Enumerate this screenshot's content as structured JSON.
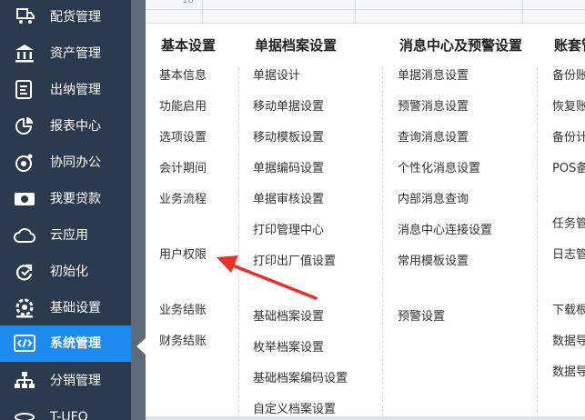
{
  "sidebar": {
    "items": [
      {
        "label": "配货管理",
        "icon": "truck-icon"
      },
      {
        "label": "资产管理",
        "icon": "bank-icon"
      },
      {
        "label": "出纳管理",
        "icon": "cashier-icon"
      },
      {
        "label": "报表中心",
        "icon": "pie-chart-icon"
      },
      {
        "label": "协同办公",
        "icon": "collaboration-icon"
      },
      {
        "label": "我要贷款",
        "icon": "money-icon"
      },
      {
        "label": "云应用",
        "icon": "cloud-icon"
      },
      {
        "label": "初始化",
        "icon": "refresh-icon"
      },
      {
        "label": "基础设置",
        "icon": "gear-icon"
      },
      {
        "label": "系统管理",
        "icon": "code-window-icon"
      },
      {
        "label": "分销管理",
        "icon": "org-tree-icon"
      },
      {
        "label": "T-UFO",
        "icon": "ufo-icon"
      }
    ],
    "active_index": 9
  },
  "grid": {
    "row_number": "10"
  },
  "menu": {
    "columns": [
      {
        "title": "基本设置",
        "items": [
          "基本信息",
          "功能启用",
          "选项设置",
          "会计期间",
          "业务流程",
          "用户权限",
          "业务结账",
          "财务结账"
        ]
      },
      {
        "title": "单据档案设置",
        "items": [
          "单据设计",
          "移动单据设置",
          "移动模板设置",
          "单据编码设置",
          "单据审核设置",
          "打印管理中心",
          "打印出厂值设置",
          "基础档案设置",
          "枚举档案设置",
          "基础档案编码设置",
          "自定义档案设置"
        ]
      },
      {
        "title": "消息中心及预警设置",
        "items": [
          "单据消息设置",
          "预警消息设置",
          "查询消息设置",
          "个性化消息设置",
          "内部消息查询",
          "消息中心连接设置",
          "常用模板设置",
          "预警设置"
        ]
      },
      {
        "title": "账套管",
        "items": [
          "备份账",
          "恢复账",
          "备份计",
          "POS备",
          "任务管",
          "日志管",
          "下载根",
          "数据导",
          "数据导"
        ]
      }
    ]
  },
  "colors": {
    "sidebar_bg": "#2b3a4d",
    "active_bg": "#1e8bf0",
    "arrow": "#e8302a"
  }
}
